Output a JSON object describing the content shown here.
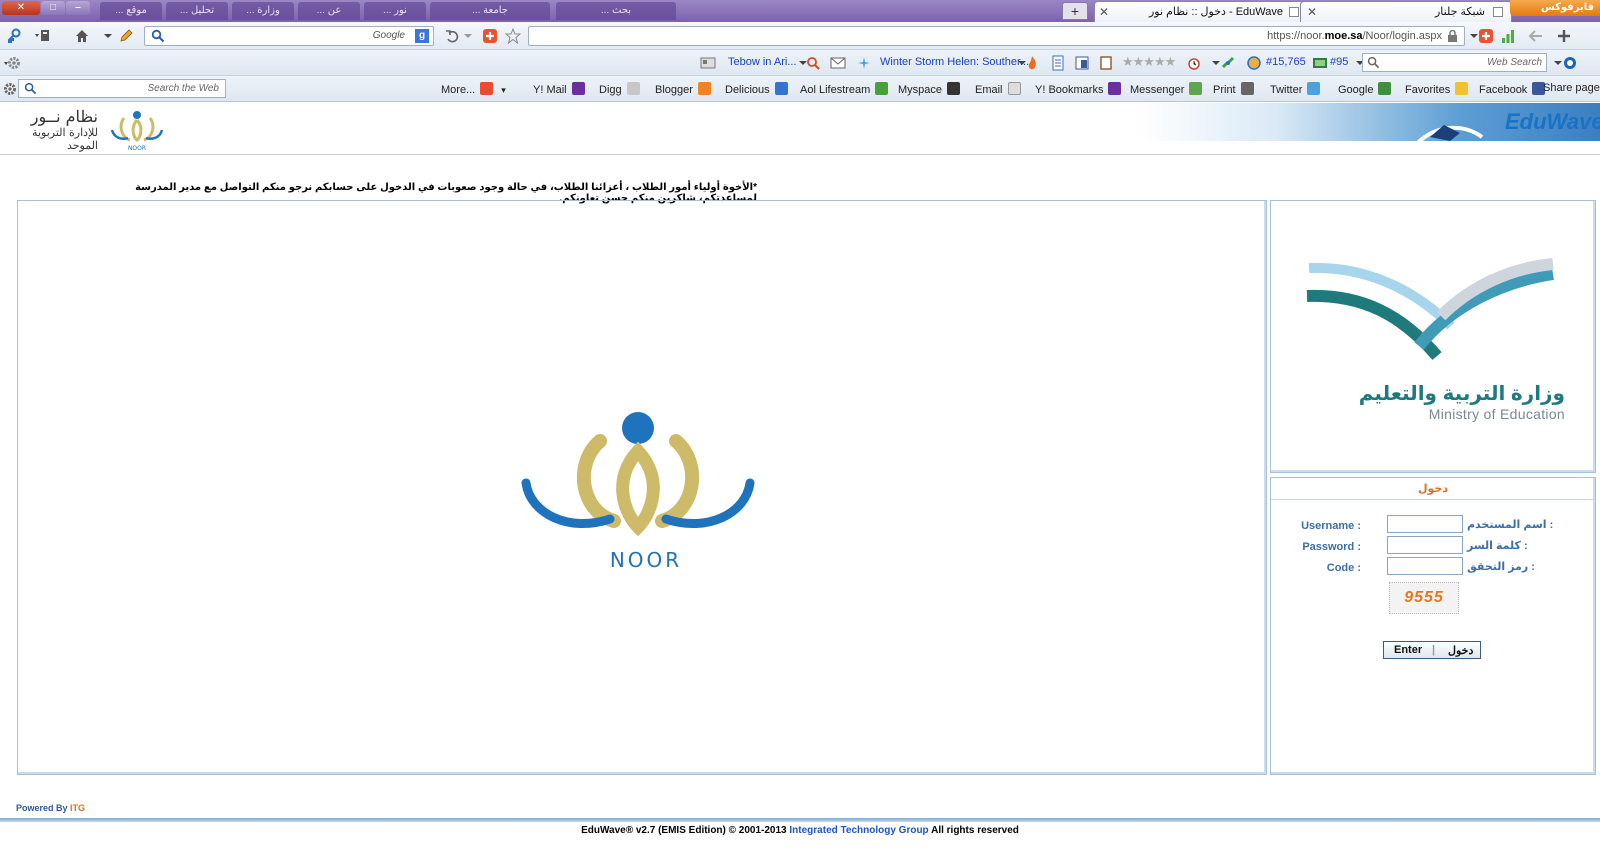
{
  "window": {
    "close_glyph": "✕",
    "max_glyph": "□",
    "min_glyph": "–",
    "firefox_button": "فايرفوكس",
    "background_tabs": [
      "موقع ...",
      "تحليل ...",
      "وزارة ...",
      "عن ...",
      "نور ...",
      "جامعة ...",
      "بحث ..."
    ],
    "newtab_glyph": "+",
    "active_tab_title": "دخول :: نظام نور - EduWave",
    "second_tab_title": "شبكة جلنار"
  },
  "navbar": {
    "search_placeholder": "Google",
    "url_prefix": "https://noor.",
    "url_domain": "moe.sa",
    "url_path": "/Noor/login.aspx"
  },
  "toolbar2": {
    "news_link": "Tebow in Ari...",
    "storm_link": "Winter Storm Helen: Souther...",
    "rank1": "#15,765",
    "rank2": "#95",
    "web_search_placeholder": "Web Search"
  },
  "bookmarks": {
    "search_placeholder": "Search the Web",
    "items": [
      {
        "label": "More...",
        "color": "#e84b2f"
      },
      {
        "label": "Y! Mail",
        "color": "#6b2fa0"
      },
      {
        "label": "Digg",
        "color": "#c7c7c7"
      },
      {
        "label": "Blogger",
        "color": "#f58220"
      },
      {
        "label": "Delicious",
        "color": "#3274d1"
      },
      {
        "label": "Aol Lifestream",
        "color": "#47a13a"
      },
      {
        "label": "Myspace",
        "color": "#333333"
      },
      {
        "label": "Email",
        "color": "#bbbbbb"
      },
      {
        "label": "Y! Bookmarks",
        "color": "#6b2fa0"
      },
      {
        "label": "Messenger",
        "color": "#5fa64b"
      },
      {
        "label": "Print",
        "color": "#666666"
      },
      {
        "label": "Twitter",
        "color": "#4aa3df"
      },
      {
        "label": "Google",
        "color": "#3f8f3f"
      },
      {
        "label": "Favorites",
        "color": "#f2c12e"
      },
      {
        "label": "Facebook",
        "color": "#3b5998"
      },
      {
        "label": "Share page:",
        "color": ""
      }
    ]
  },
  "page": {
    "brand_ar": "نظام نــور",
    "brand_ar_sub": "للإدارة التربوية الموحد",
    "eduwave_logo": "EduWave",
    "notice": "*الأخوة أولياء أمور الطلاب ، أعزائنا الطلاب، في حالة وجود صعوبات في الدخول على حسابكم نرجو منكم التواصل مع مدير المدرسة لمساعدتكم، شاكرين منكم حسن تعاونكم.",
    "noor_logo_text": "NOOR",
    "moe_ar": "وزارة التربية والتعليم",
    "moe_en": "Ministry of Education",
    "noor_small": "NOOR"
  },
  "login": {
    "title": "دخول",
    "username_en": "Username :",
    "username_ar": ": اسم المستخدم",
    "username_value": "",
    "password_en": "Password :",
    "password_ar": ": كلمة السر",
    "password_value": "",
    "code_en": "Code :",
    "code_ar": ": رمز التحقق",
    "code_value": "",
    "captcha_text": "9555",
    "enter_en": "Enter",
    "enter_ar": "دخول",
    "separator": "|"
  },
  "footer": {
    "powered_by": "Powered By",
    "itg": "ITG",
    "copyright_prefix": "EduWave® v2.7 (EMIS Edition) © 2001-2013",
    "company": "Integrated Technology Group",
    "rights": "All rights reserved"
  },
  "colors": {
    "noor_blue": "#1f73bd",
    "noor_gold": "#cdbb6a",
    "moe_teal": "#1f7a7c",
    "moe_light_blue": "#a7d5ec",
    "moe_grey": "#cfd5dc",
    "link_blue": "#1a3fc4"
  }
}
